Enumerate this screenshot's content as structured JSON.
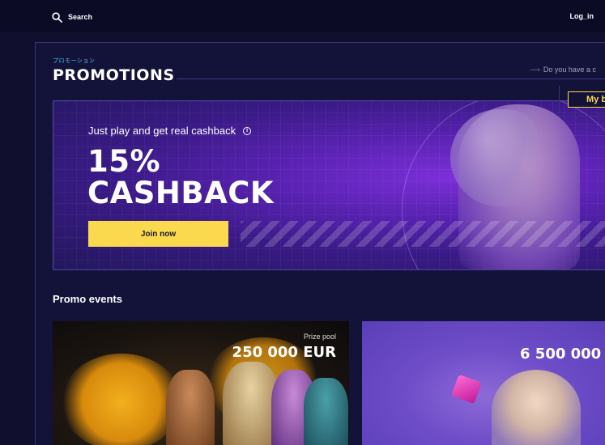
{
  "topbar": {
    "search_label": "Search",
    "login_label": "Log_in"
  },
  "promotions": {
    "kicker": "プロモーション",
    "title": "PROMOTIONS",
    "voucher_hint": "Do you have a c",
    "my_bonus_label": "My b"
  },
  "banner": {
    "subtitle": "Just play and get real cashback",
    "headline_line1": "15%",
    "headline_line2": "CASHBACK",
    "join_label": "Join now",
    "accent_color": "#fbd94f"
  },
  "events": {
    "title": "Promo events",
    "cards": [
      {
        "prize_label": "Prize pool",
        "prize_value": "250 000 EUR"
      },
      {
        "prize_value": "6 500 000"
      }
    ]
  },
  "icons": {
    "search": "search-icon",
    "info": "info-icon",
    "arrow": "arrow-right-icon"
  }
}
